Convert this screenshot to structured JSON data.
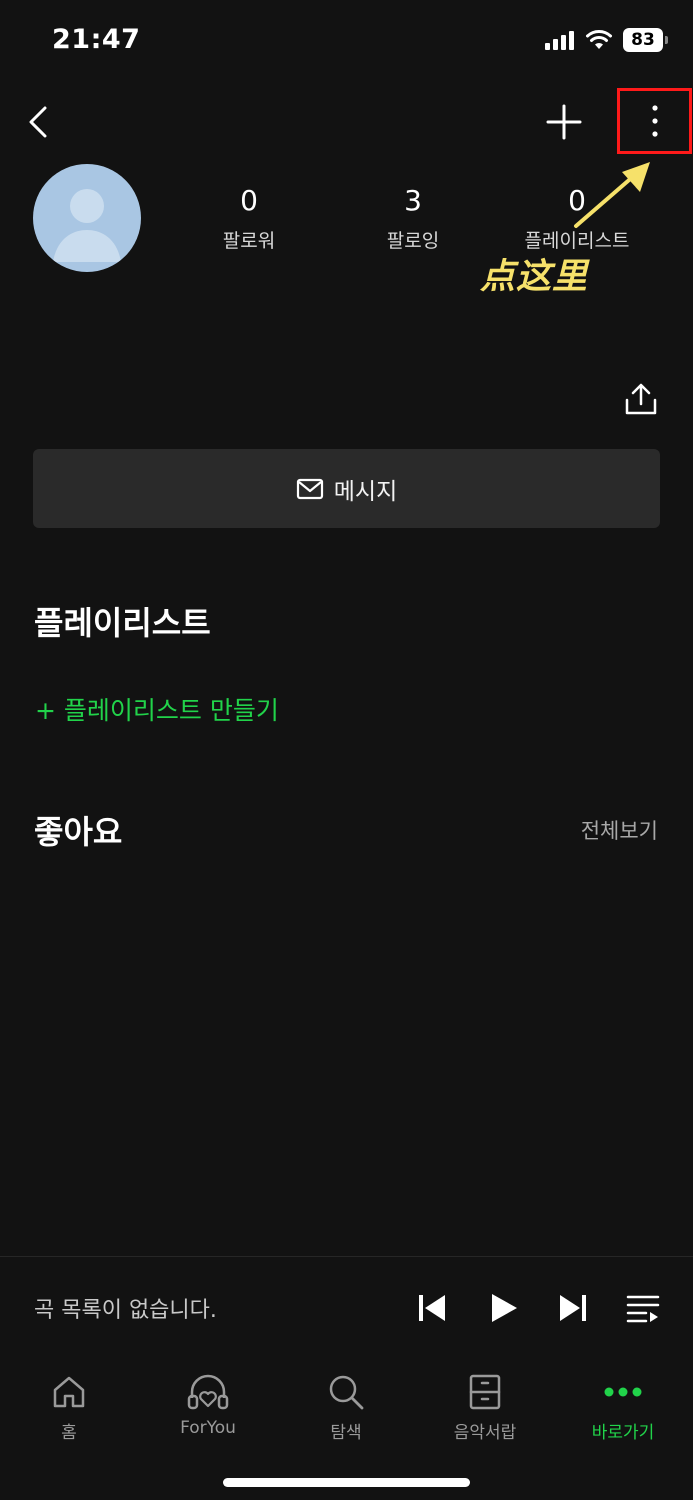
{
  "status_bar": {
    "time": "21:47",
    "battery": "83"
  },
  "profile": {
    "stats": [
      {
        "value": "0",
        "label": "팔로워"
      },
      {
        "value": "3",
        "label": "팔로잉"
      },
      {
        "value": "0",
        "label": "플레이리스트"
      }
    ]
  },
  "annotation": {
    "text": "点这里",
    "color": "#f6e16a",
    "highlight_color": "#ff1a1a"
  },
  "actions": {
    "message_label": "메시지"
  },
  "playlist_section": {
    "title": "플레이리스트",
    "create_label": "+ 플레이리스트 만들기"
  },
  "likes_section": {
    "title": "좋아요",
    "see_all_label": "전체보기"
  },
  "player": {
    "status_text": "곡 목록이 없습니다."
  },
  "tabs": [
    {
      "label": "홈",
      "icon": "home-icon",
      "active": false
    },
    {
      "label": "ForYou",
      "icon": "headphones-heart-icon",
      "active": false
    },
    {
      "label": "탐색",
      "icon": "search-icon",
      "active": false
    },
    {
      "label": "음악서랍",
      "icon": "drawer-icon",
      "active": false
    },
    {
      "label": "바로가기",
      "icon": "more-dots-icon",
      "active": true
    }
  ],
  "colors": {
    "background": "#121212",
    "accent": "#21d34a",
    "surface": "#2a2a2a"
  }
}
